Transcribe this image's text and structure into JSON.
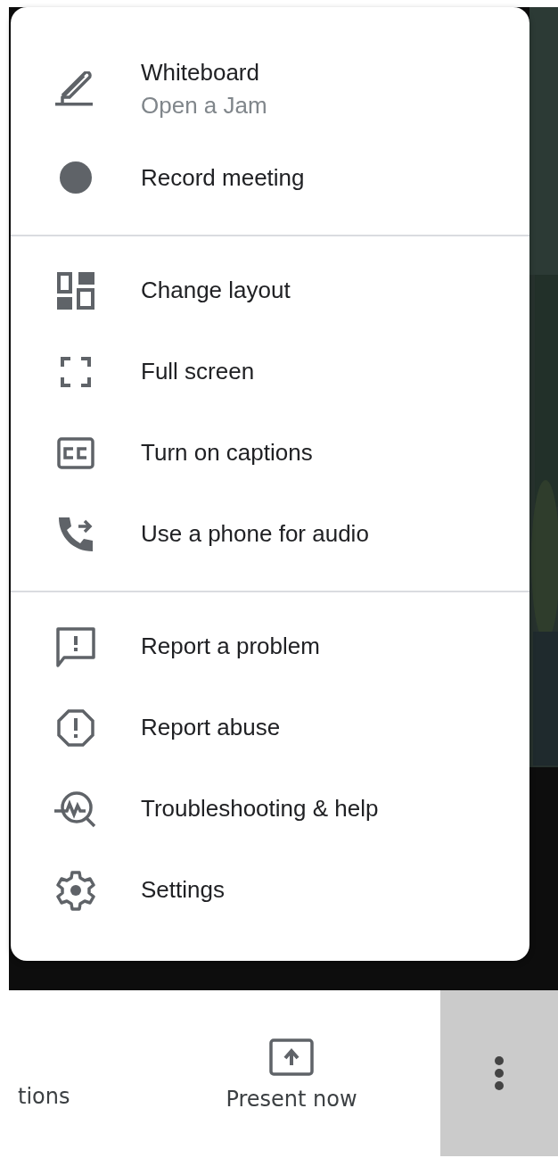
{
  "menu": {
    "sections": [
      {
        "items": [
          {
            "label": "Whiteboard",
            "sublabel": "Open a Jam"
          },
          {
            "label": "Record meeting"
          }
        ]
      },
      {
        "items": [
          {
            "label": "Change layout"
          },
          {
            "label": "Full screen"
          },
          {
            "label": "Turn on captions"
          },
          {
            "label": "Use a phone for audio"
          }
        ]
      },
      {
        "items": [
          {
            "label": "Report a problem"
          },
          {
            "label": "Report abuse"
          },
          {
            "label": "Troubleshooting & help"
          },
          {
            "label": "Settings"
          }
        ]
      }
    ]
  },
  "bottom_bar": {
    "items": [
      {
        "label": "tions"
      },
      {
        "label": "Present now"
      }
    ],
    "more_button": {
      "selected": true
    }
  }
}
